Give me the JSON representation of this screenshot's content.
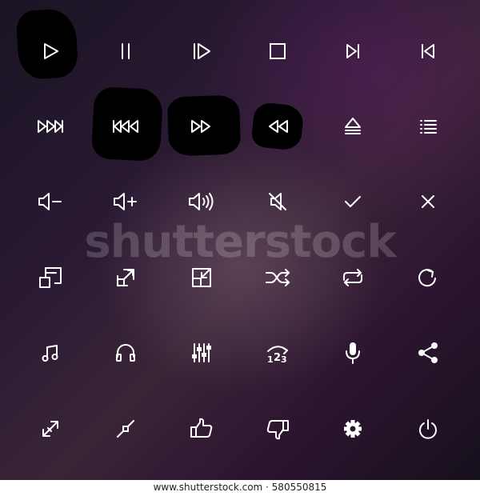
{
  "watermark": "shutterstock",
  "footer": {
    "text": "www.shutterstock.com · 580550815"
  },
  "colors": {
    "icon": "#ffffff",
    "scribble": "#000000"
  },
  "icon_rows": [
    [
      "play-icon",
      "pause-icon",
      "step-play-icon",
      "stop-icon",
      "skip-next-icon",
      "skip-previous-icon"
    ],
    [
      "fast-forward-end-icon",
      "rewind-start-icon",
      "fast-forward-icon",
      "rewind-icon",
      "eject-icon",
      "playlist-icon"
    ],
    [
      "volume-down-icon",
      "volume-up-icon",
      "volume-loud-icon",
      "mute-icon",
      "checkmark-icon",
      "close-icon"
    ],
    [
      "shrink-windows-icon",
      "expand-diagonal-icon",
      "collapse-diagonal-icon",
      "shuffle-icon",
      "repeat-icon",
      "refresh-icon"
    ],
    [
      "music-note-icon",
      "headphones-icon",
      "equalizer-icon",
      "track-order-icon",
      "microphone-icon",
      "share-icon"
    ],
    [
      "expand-arrows-icon",
      "shrink-arrows-icon",
      "thumbs-up-icon",
      "thumbs-down-icon",
      "settings-gear-icon",
      "power-icon"
    ]
  ]
}
